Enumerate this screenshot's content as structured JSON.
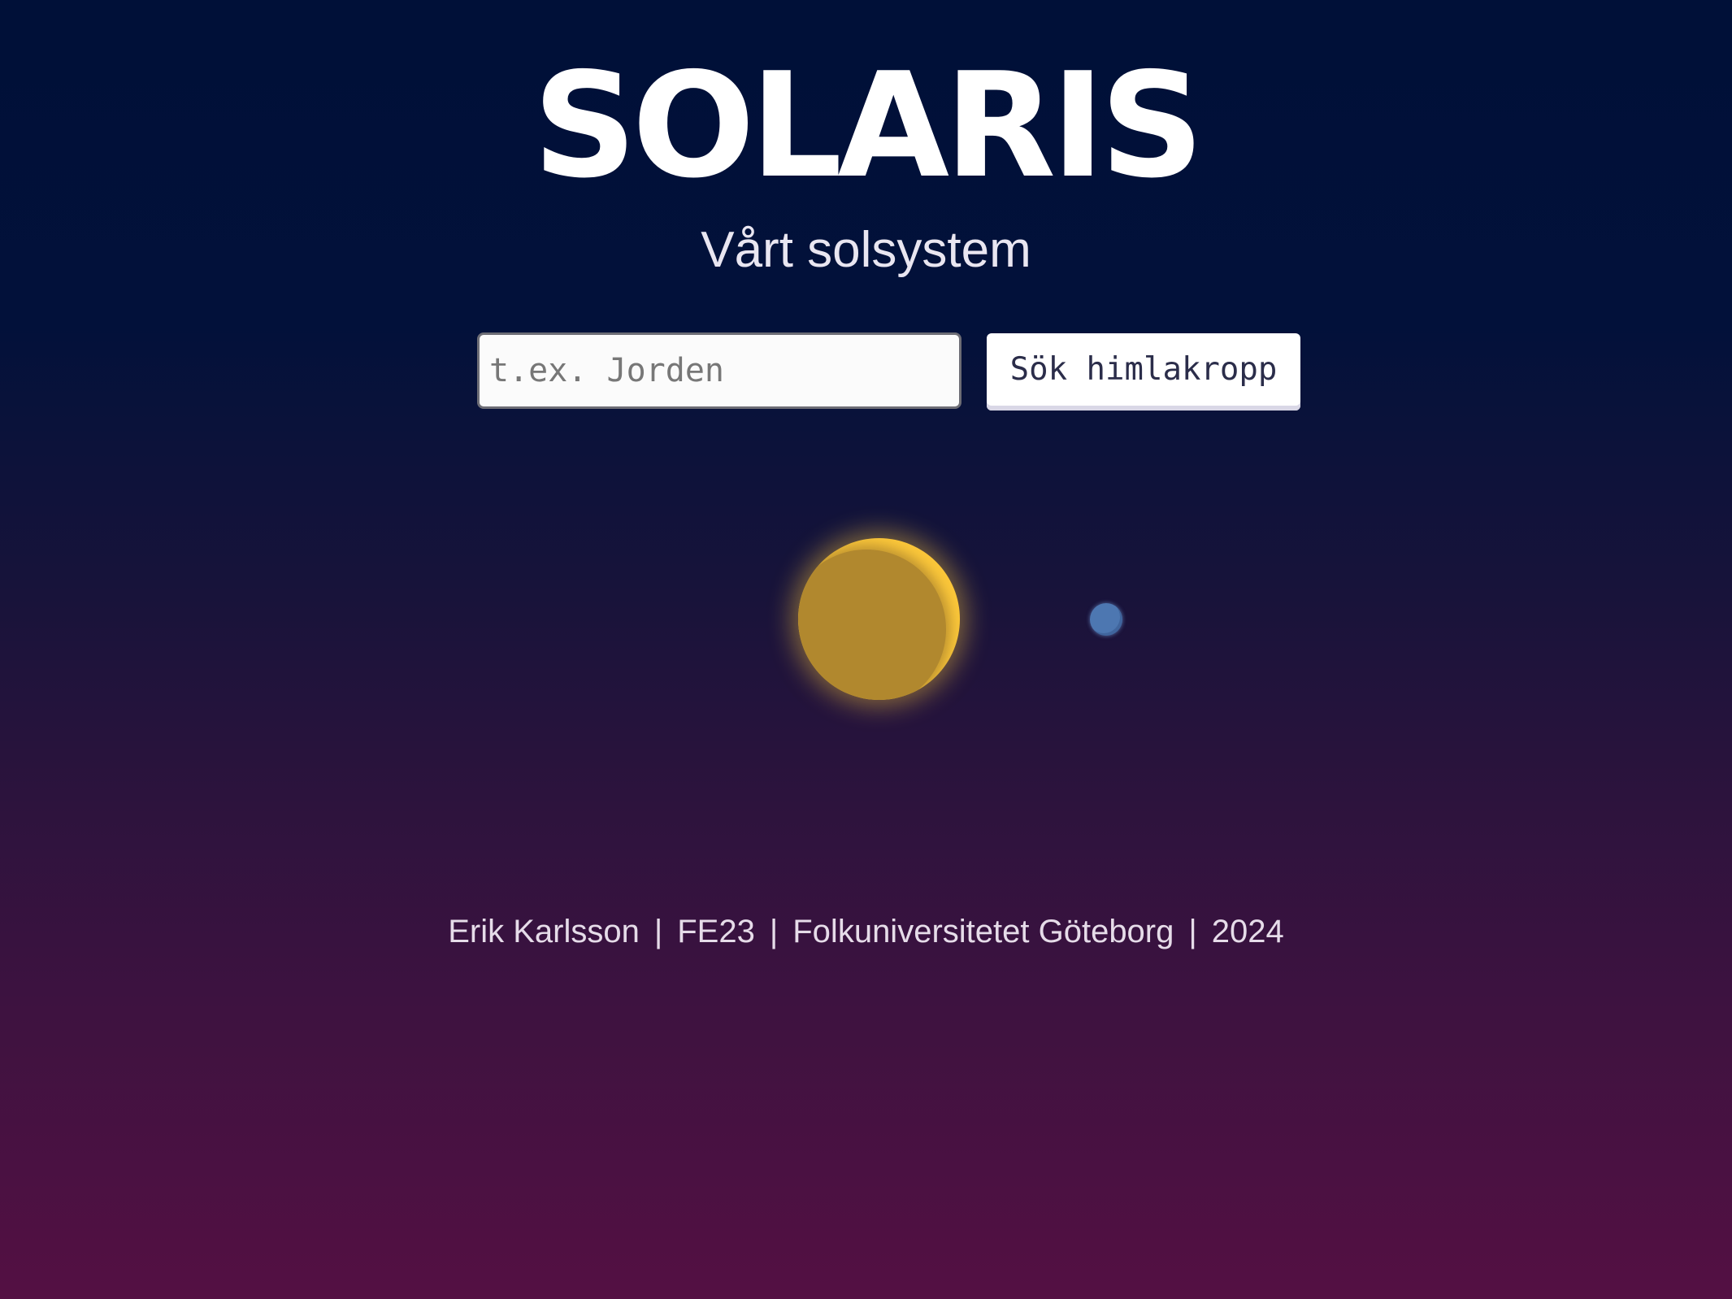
{
  "header": {
    "title": "SOLARIS",
    "subtitle": "Vårt solsystem"
  },
  "search": {
    "placeholder": "t.ex. Jorden",
    "value": "",
    "button_label": "Sök himlakropp"
  },
  "solar_system": {
    "sun": {
      "name": "sun",
      "color": "#fbc73a",
      "shade_color": "#b1882e"
    },
    "planets": [
      {
        "name": "planet",
        "color": "#4d77b1"
      }
    ]
  },
  "footer": {
    "author": "Erik Karlsson",
    "separator": "|",
    "class": "FE23",
    "school": "Folkuniversitetet Göteborg",
    "year": "2024"
  },
  "colors": {
    "background_top": "#001038",
    "background_bottom": "#541043",
    "text": "#ffffff"
  }
}
